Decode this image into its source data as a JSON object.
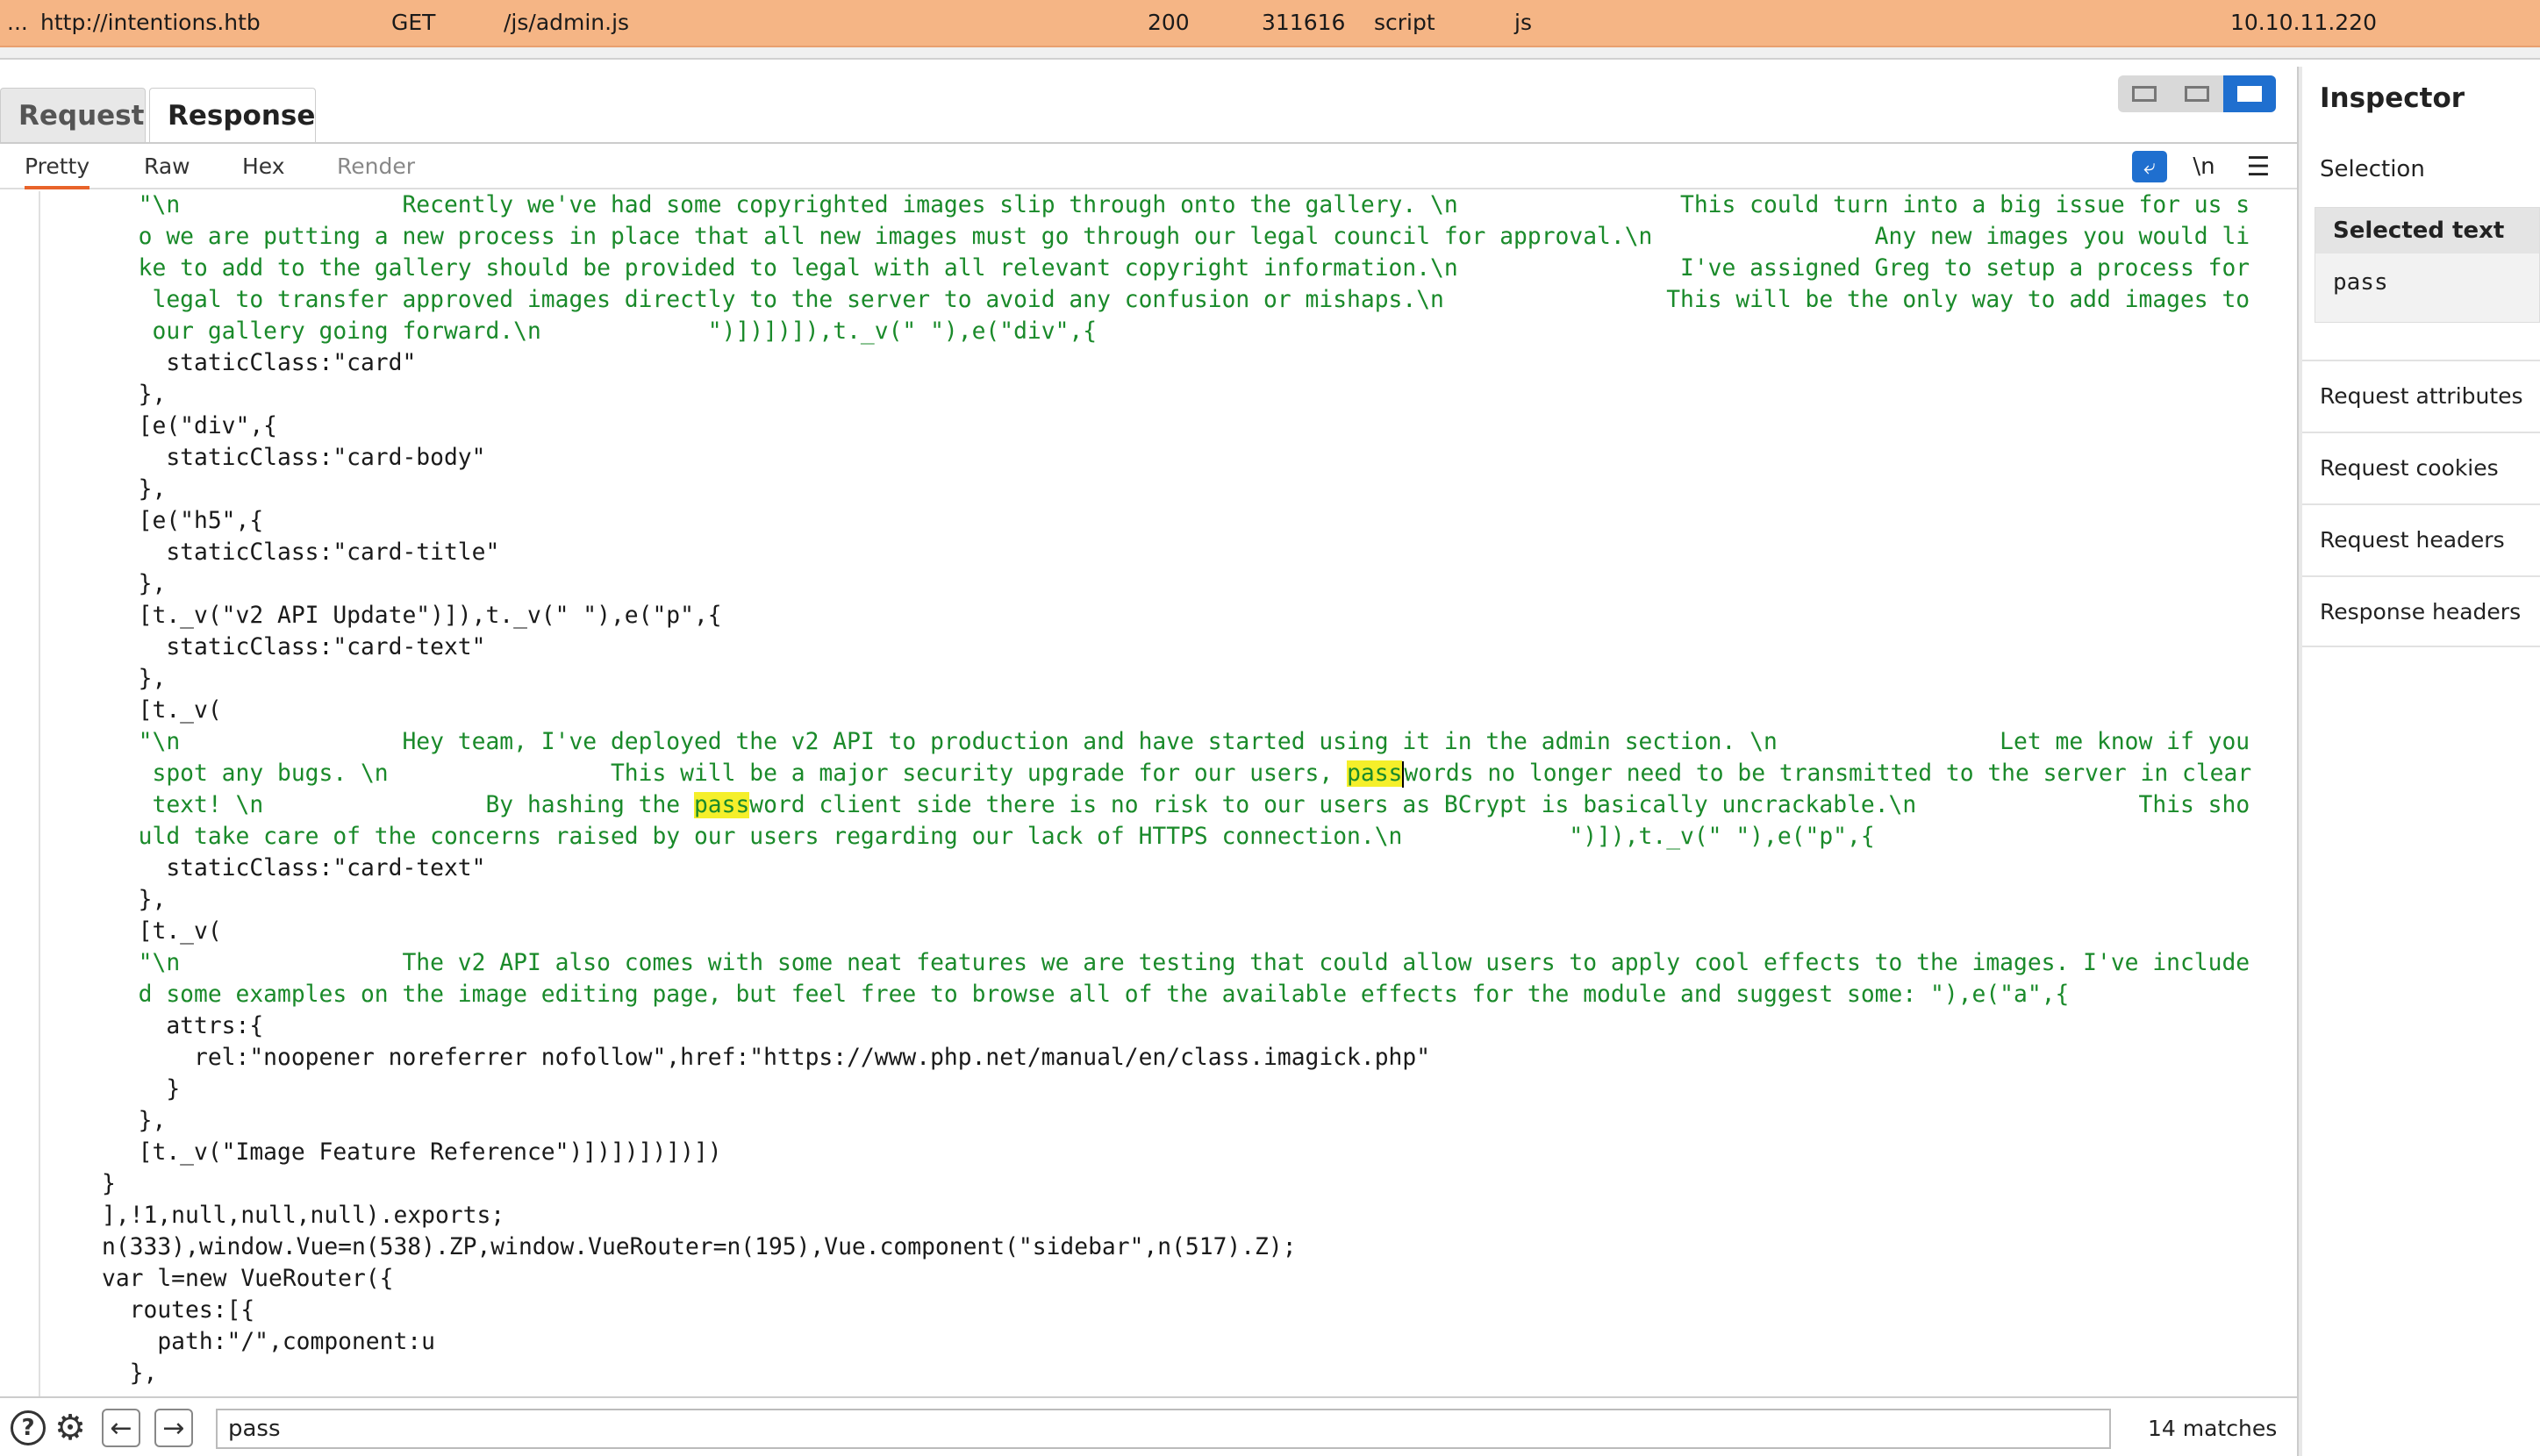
{
  "request_row": {
    "index": "...",
    "host": "http://intentions.htb",
    "method": "GET",
    "url": "/js/admin.js",
    "status": "200",
    "length": "311616",
    "mime": "script",
    "extension": "js",
    "ip": "10.10.11.220",
    "highlight_color": "#f5b585"
  },
  "tabs": [
    {
      "label": "Request"
    },
    {
      "label": "Response"
    }
  ],
  "subtabs": [
    {
      "label": "Pretty"
    },
    {
      "label": "Raw"
    },
    {
      "label": "Hex"
    },
    {
      "label": "Render"
    }
  ],
  "toolbar": {
    "newline_label": "\\n",
    "menu_glyph": "☰",
    "wrap_glyph": "⤶"
  },
  "code": {
    "line_01_a": "  \"\\n                Recently we've had some copyrighted images slip through onto the gallery. \\n                This could turn into a big issue for us s",
    "line_02_a": "  o we are putting a new process in place that all new images must go through our legal council for approval.\\n                Any new images you would li",
    "line_03_a": "  ke to add to the gallery should be provided to legal with all relevant copyright information.\\n                I've assigned Greg to setup a process for",
    "line_04_a": "   legal to transfer approved images directly to the server to avoid any confusion or mishaps.\\n                This will be the only way to add images to",
    "line_05_a": "   our gallery going forward.\\n            \")])])]),t._v(\" \"),e(\"div\",{",
    "line_06": "    staticClass:\"card\"",
    "line_07": "  },",
    "line_08": "  [e(\"div\",{",
    "line_09": "    staticClass:\"card-body\"",
    "line_10": "  },",
    "line_11": "  [e(\"h5\",{",
    "line_12": "    staticClass:\"card-title\"",
    "line_13": "  },",
    "line_14": "  [t._v(\"v2 API Update\")]),t._v(\" \"),e(\"p\",{",
    "line_15": "    staticClass:\"card-text\"",
    "line_16": "  },",
    "line_17": "  [t._v(",
    "line_18": "  \"\\n                Hey team, I've deployed the v2 API to production and have started using it in the admin section. \\n                Let me know if you",
    "line_19_pre": "   spot any bugs. \\n                This will be a major security upgrade for our users, ",
    "line_19_hl": "pass",
    "line_19_post": "words no longer need to be transmitted to the server in clear",
    "line_20_pre": "   text! \\n                By hashing the ",
    "line_20_hl": "pass",
    "line_20_post": "word client side there is no risk to our users as BCrypt is basically uncrackable.\\n                This sho",
    "line_21": "  uld take care of the concerns raised by our users regarding our lack of HTTPS connection.\\n            \")]),t._v(\" \"),e(\"p\",{",
    "line_22": "    staticClass:\"card-text\"",
    "line_23": "  },",
    "line_24": "  [t._v(",
    "line_25": "  \"\\n                The v2 API also comes with some neat features we are testing that could allow users to apply cool effects to the images. I've include",
    "line_26": "  d some examples on the image editing page, but feel free to browse all of the available effects for the module and suggest some: \"),e(\"a\",{",
    "line_27": "    attrs:{",
    "line_28": "      rel:\"noopener noreferrer nofollow\",href:\"https://www.php.net/manual/en/class.imagick.php\"",
    "line_29": "    }",
    "line_30": "  },",
    "line_31": "  [t._v(\"Image Feature Reference\")])])])])])",
    "line_32": "}",
    "line_33": "],!1,null,null,null).exports;",
    "line_34": "n(333),window.Vue=n(538).ZP,window.VueRouter=n(195),Vue.component(\"sidebar\",n(517).Z);",
    "line_35": "var l=new VueRouter({",
    "line_36": "  routes:[{",
    "line_37": "    path:\"/\",component:u",
    "line_38": "  },"
  },
  "search": {
    "value": "pass",
    "matches": "14 matches"
  },
  "inspector": {
    "title": "Inspector",
    "selection": "Selection",
    "selected_text_label": "Selected text",
    "selected_text_value": "pass",
    "items": [
      {
        "label": "Request attributes"
      },
      {
        "label": "Request cookies"
      },
      {
        "label": "Request headers"
      },
      {
        "label": "Response headers"
      }
    ]
  }
}
